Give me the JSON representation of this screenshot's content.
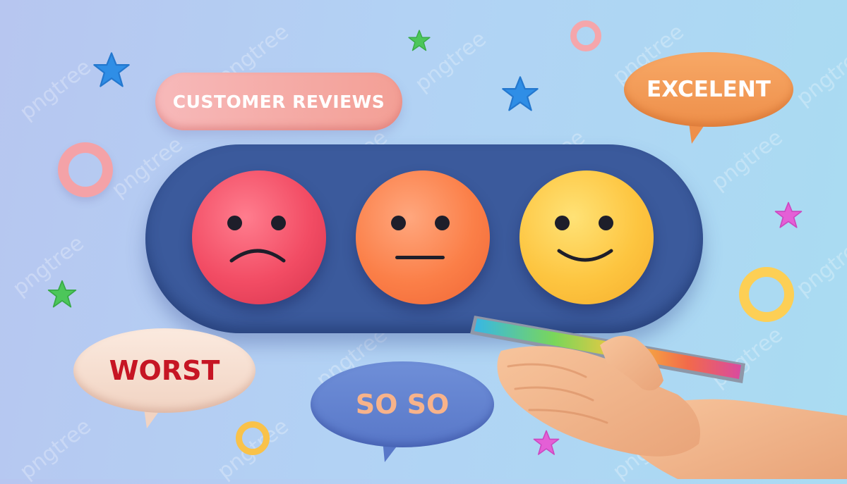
{
  "banner": {
    "title": "CUSTOMER REVIEWS"
  },
  "faces": [
    {
      "name": "sad",
      "color": "#f24c64"
    },
    {
      "name": "neutral",
      "color": "#fb7f48"
    },
    {
      "name": "happy",
      "color": "#fdc540"
    }
  ],
  "bubbles": {
    "excelent": "EXCELENT",
    "worst": "WORST",
    "soso": "SO SO"
  },
  "watermark": {
    "text": "pngtree"
  },
  "colors": {
    "panel": "#3b5a9c",
    "banner": "#f39f95",
    "worst_text": "#c61524",
    "soso_text": "#f8b38a"
  }
}
